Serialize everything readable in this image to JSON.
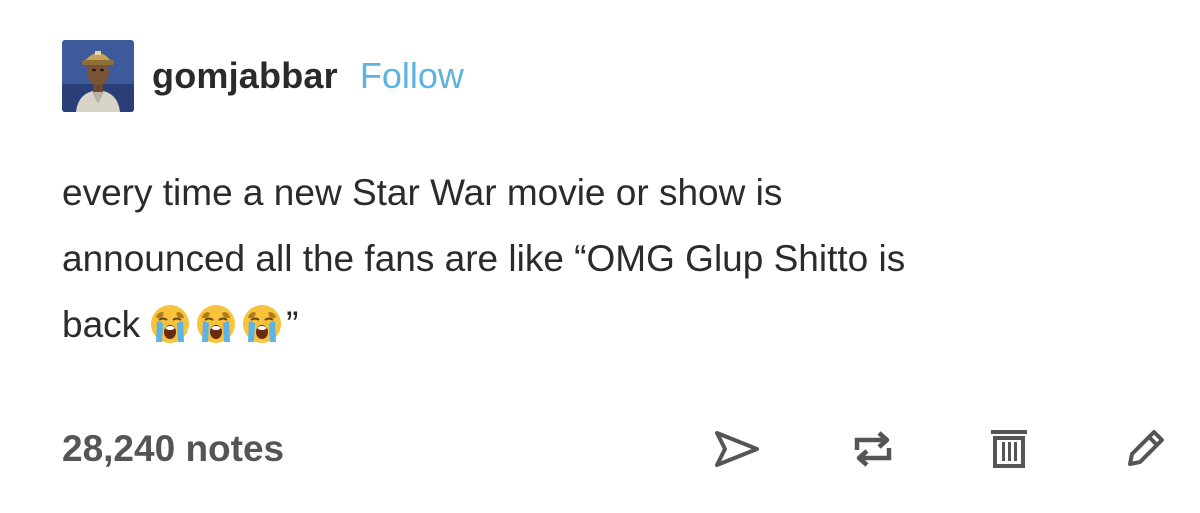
{
  "post": {
    "username": "gomjabbar",
    "follow_label": "Follow",
    "body_lines": [
      "every time a new Star War movie or show is",
      "announced all the fans are like “OMG Glup Shitto is",
      "back"
    ],
    "closing_quote": "”",
    "emojis": [
      "loudly-crying-face",
      "loudly-crying-face",
      "loudly-crying-face"
    ],
    "notes_label": "28,240 notes"
  },
  "icons": {
    "share": "paper-plane-icon",
    "reblog": "reblog-icon",
    "delete": "trash-icon",
    "edit": "pencil-icon"
  },
  "colors": {
    "follow": "#5fb3e0",
    "text": "#2b2b2b",
    "notes": "#555555",
    "icons": "#555555"
  }
}
